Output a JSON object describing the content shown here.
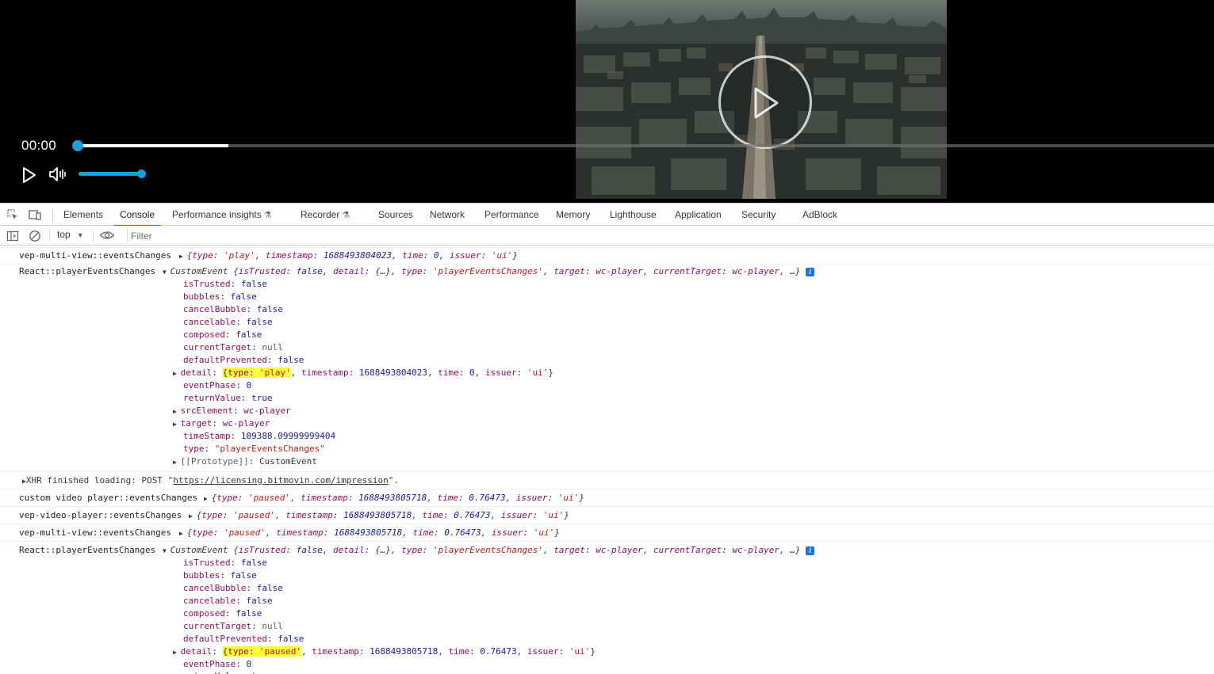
{
  "player": {
    "time": "00:00",
    "progress_buffered_fraction": 0.135,
    "volume_fraction": 1.0,
    "icons": [
      "play-icon",
      "volume-icon",
      "big-play-icon"
    ]
  },
  "devtools": {
    "tabs": [
      {
        "label": "Elements"
      },
      {
        "label": "Console"
      },
      {
        "label": "Performance insights",
        "flask": "⚗"
      },
      {
        "label": "Recorder",
        "flask": "⚗"
      },
      {
        "label": "Sources"
      },
      {
        "label": "Network"
      },
      {
        "label": "Performance"
      },
      {
        "label": "Memory"
      },
      {
        "label": "Lighthouse"
      },
      {
        "label": "Application"
      },
      {
        "label": "Security"
      },
      {
        "label": "AdBlock"
      }
    ],
    "active_tab": "Console",
    "context": "top",
    "filter_placeholder": "Filter"
  },
  "console": {
    "m1_src": "vep-multi-view::eventsChanges",
    "m1": {
      "type": "'play'",
      "timestamp": "1688493804023",
      "time": "0",
      "issuer": "'ui'"
    },
    "m2_src": "React::playerEventsChanges",
    "m2_head": {
      "ctor": "CustomEvent",
      "isTrusted": "false",
      "detail": "{…}",
      "type": "'playerEventsChanges'",
      "target": "wc-player",
      "currentTarget": "wc-player"
    },
    "m2_props": {
      "isTrusted": "false",
      "bubbles": "false",
      "cancelBubble": "false",
      "cancelable": "false",
      "composed": "false",
      "currentTarget": "null",
      "defaultPrevented": "false",
      "detail_type": "'play'",
      "detail_timestamp": "1688493804023",
      "detail_time": "0",
      "detail_issuer": "'ui'",
      "eventPhase": "0",
      "returnValue": "true",
      "srcElement": "wc-player",
      "target": "wc-player",
      "timeStamp": "109388.09999999404",
      "type": "\"playerEventsChanges\"",
      "prototype": "CustomEvent"
    },
    "xhr": {
      "text": "XHR finished loading: POST \"",
      "url": "https://licensing.bitmovin.com/impression",
      "tail": "\"."
    },
    "m3_src": "custom video player::eventsChanges",
    "m3": {
      "type": "'paused'",
      "timestamp": "1688493805718",
      "time": "0.76473",
      "issuer": "'ui'"
    },
    "m4_src": "vep-video-player::eventsChanges",
    "m4": {
      "type": "'paused'",
      "timestamp": "1688493805718",
      "time": "0.76473",
      "issuer": "'ui'"
    },
    "m5_src": "vep-multi-view::eventsChanges",
    "m5": {
      "type": "'paused'",
      "timestamp": "1688493805718",
      "time": "0.76473",
      "issuer": "'ui'"
    },
    "m6_src": "React::playerEventsChanges",
    "m6_head": {
      "ctor": "CustomEvent",
      "isTrusted": "false",
      "detail": "{…}",
      "type": "'playerEventsChanges'",
      "target": "wc-player",
      "currentTarget": "wc-player"
    },
    "m6_props": {
      "isTrusted": "false",
      "bubbles": "false",
      "cancelBubble": "false",
      "cancelable": "false",
      "composed": "false",
      "currentTarget": "null",
      "defaultPrevented": "false",
      "detail_type": "'paused'",
      "detail_timestamp": "1688493805718",
      "detail_time": "0.76473",
      "detail_issuer": "'ui'",
      "eventPhase": "0",
      "returnValue": "true"
    }
  }
}
